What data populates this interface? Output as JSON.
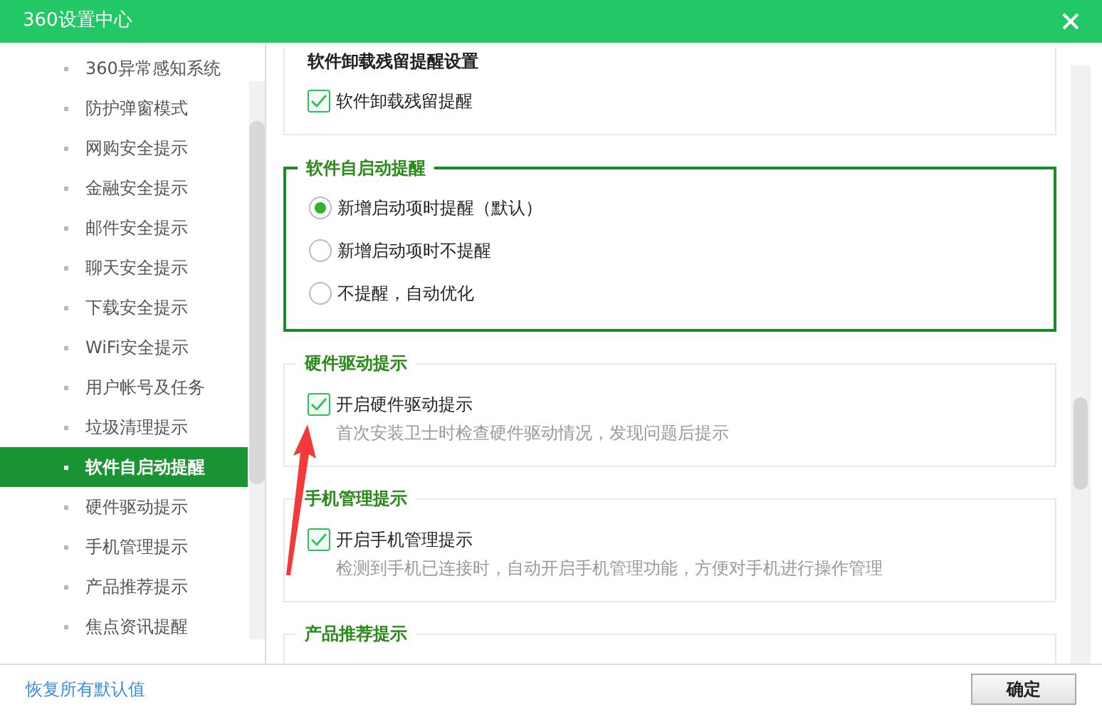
{
  "window": {
    "title": "360设置中心"
  },
  "sidebar": {
    "items": [
      {
        "label": "360异常感知系统",
        "selected": false
      },
      {
        "label": "防护弹窗模式",
        "selected": false
      },
      {
        "label": "网购安全提示",
        "selected": false
      },
      {
        "label": "金融安全提示",
        "selected": false
      },
      {
        "label": "邮件安全提示",
        "selected": false
      },
      {
        "label": "聊天安全提示",
        "selected": false
      },
      {
        "label": "下载安全提示",
        "selected": false
      },
      {
        "label": "WiFi安全提示",
        "selected": false
      },
      {
        "label": "用户帐号及任务",
        "selected": false
      },
      {
        "label": "垃圾清理提示",
        "selected": false
      },
      {
        "label": "软件自启动提醒",
        "selected": true
      },
      {
        "label": "硬件驱动提示",
        "selected": false
      },
      {
        "label": "手机管理提示",
        "selected": false
      },
      {
        "label": "产品推荐提示",
        "selected": false
      },
      {
        "label": "焦点资讯提醒",
        "selected": false
      }
    ]
  },
  "sections": [
    {
      "kind": "plain",
      "heading": "软件卸载残留提醒设置",
      "options": [
        {
          "kind": "checkbox",
          "label": "软件卸载残留提醒",
          "checked": true
        }
      ]
    },
    {
      "kind": "highlighted",
      "heading": "软件自启动提醒",
      "options": [
        {
          "kind": "radio",
          "label": "新增启动项时提醒（默认）",
          "selected": true
        },
        {
          "kind": "radio",
          "label": "新增启动项时不提醒",
          "selected": false
        },
        {
          "kind": "radio",
          "label": "不提醒，自动优化",
          "selected": false
        }
      ]
    },
    {
      "kind": "group",
      "heading": "硬件驱动提示",
      "options": [
        {
          "kind": "checkbox",
          "label": "开启硬件驱动提示",
          "checked": true,
          "description": "首次安装卫士时检查硬件驱动情况，发现问题后提示"
        }
      ]
    },
    {
      "kind": "group",
      "heading": "手机管理提示",
      "options": [
        {
          "kind": "checkbox",
          "label": "开启手机管理提示",
          "checked": true,
          "description": "检测到手机已连接时，自动开启手机管理功能，方便对手机进行操作管理"
        }
      ]
    },
    {
      "kind": "group",
      "heading": "产品推荐提示"
    }
  ],
  "footer": {
    "reset_link": "恢复所有默认值",
    "ok_button": "确定"
  }
}
